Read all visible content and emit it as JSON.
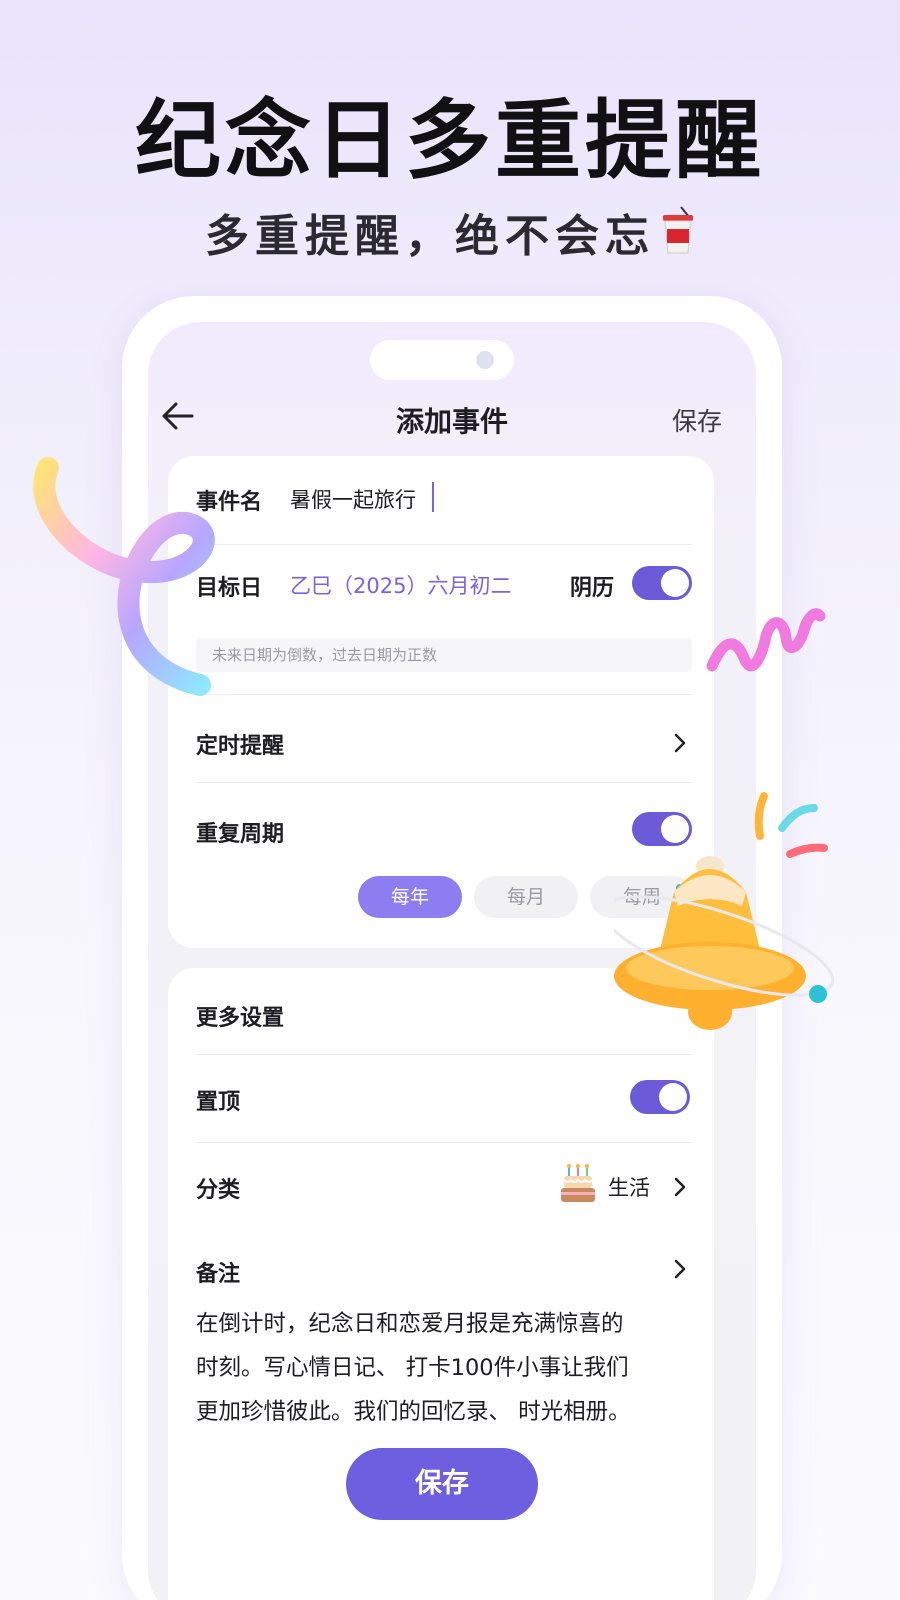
{
  "promo": {
    "headline": "纪念日多重提醒",
    "subline": "多重提醒，绝不会忘"
  },
  "nav": {
    "title": "添加事件",
    "save_label": "保存"
  },
  "form": {
    "event_name_label": "事件名",
    "event_name_value": "暑假一起旅行",
    "target_date_label": "目标日",
    "target_date_value": "乙巳（2025）六月初二",
    "lunar_label": "阴历",
    "lunar_on": true,
    "date_hint": "未来日期为倒数，过去日期为正数",
    "timed_reminder_label": "定时提醒",
    "repeat_label": "重复周期",
    "repeat_on": true,
    "repeat_options": [
      "每年",
      "每月",
      "每周"
    ],
    "repeat_selected": "每年"
  },
  "more": {
    "section_label": "更多设置",
    "pin_label": "置顶",
    "pin_on": true,
    "category_label": "分类",
    "category_value": "生活",
    "category_icon": "birthday-cake-icon",
    "note_label": "备注",
    "note_lines": [
      "在倒计时，纪念日和恋爱月报是充满惊喜的",
      "时刻。写心情日记、 打卡100件小事让我们",
      "更加珍惜彼此。我们的回忆录、 时光相册。"
    ]
  },
  "footer": {
    "save_button_label": "保存"
  },
  "colors": {
    "accent": "#6e5ee0",
    "toggle": "#6b5bd9",
    "accent_text": "#7a62e8",
    "pill_selected": "#8d7df0",
    "pill_unselected": "#f1f1f4"
  }
}
